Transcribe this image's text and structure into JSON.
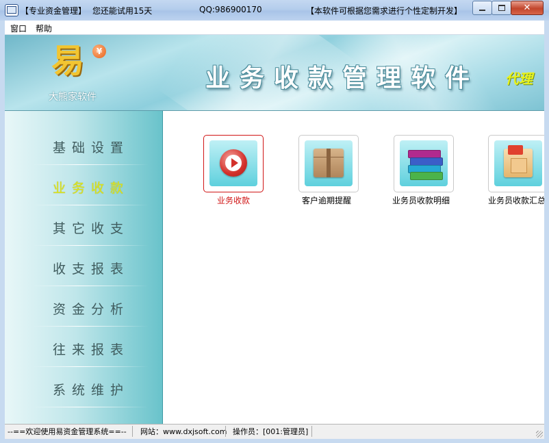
{
  "window": {
    "title_segments": [
      "【专业资金管理】",
      "您还能试用15天",
      "QQ:986900170",
      "【本软件可根据您需求进行个性定制开发】"
    ],
    "buttons": [
      "minimize",
      "maximize",
      "close"
    ]
  },
  "menu": {
    "items": [
      "窗口",
      "帮助"
    ]
  },
  "banner": {
    "company": "大熊家软件",
    "logo_glyph": "易",
    "badge_glyph": "¥",
    "title": "业务收款管理软件",
    "subtitle": "代理"
  },
  "nav": {
    "items": [
      {
        "label": "基础设置",
        "active": false
      },
      {
        "label": "业务收款",
        "active": true
      },
      {
        "label": "其它收支",
        "active": false
      },
      {
        "label": "收支报表",
        "active": false
      },
      {
        "label": "资金分析",
        "active": false
      },
      {
        "label": "往来报表",
        "active": false
      },
      {
        "label": "系统维护",
        "active": false
      }
    ]
  },
  "tiles": [
    {
      "label": "业务收款",
      "icon": "play-arrow-icon",
      "selected": true
    },
    {
      "label": "客户逾期提醒",
      "icon": "package-box-icon",
      "selected": false
    },
    {
      "label": "业务员收款明细",
      "icon": "book-stack-icon",
      "selected": false
    },
    {
      "label": "业务员收款汇总",
      "icon": "folder-document-icon",
      "selected": false
    }
  ],
  "status": {
    "welcome": "--==欢迎使用易资金管理系统==--",
    "website": "网站：www.dxjsoft.com",
    "operator": "操作员：[001:管理员]"
  },
  "colors": {
    "selected_red": "#d01414",
    "nav_active": "#dfe51a",
    "banner_teal": "#8ecfdd"
  }
}
